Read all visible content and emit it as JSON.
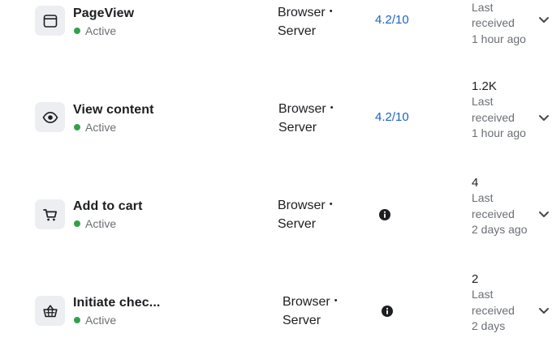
{
  "events": [
    {
      "icon": "browser-window-icon",
      "name": "PageView",
      "status": "Active",
      "integration_line1": "Browser",
      "integration_separator": "•",
      "integration_line2": "Server",
      "quality_score": "4.2/10",
      "count": "",
      "activity_label": "Last received",
      "activity_time": "1 hour ago"
    },
    {
      "icon": "eye-icon",
      "name": "View content",
      "status": "Active",
      "integration_line1": "Browser",
      "integration_separator": "•",
      "integration_line2": "Server",
      "quality_score": "4.2/10",
      "count": "1.2K",
      "activity_label": "Last received",
      "activity_time": "1 hour ago"
    },
    {
      "icon": "shopping-cart-icon",
      "name": "Add to cart",
      "status": "Active",
      "integration_line1": "Browser",
      "integration_separator": "•",
      "integration_line2": "Server",
      "quality_score_icon": "info-icon",
      "count": "4",
      "activity_label": "Last received",
      "activity_time": "2 days ago"
    },
    {
      "icon": "shopping-basket-icon",
      "name": "Initiate chec...",
      "status": "Active",
      "integration_line1": "Browser",
      "integration_separator": "•",
      "integration_line2": "Server",
      "quality_score_icon": "info-icon",
      "count": "2",
      "activity_label": "Last received",
      "activity_time": "2 days"
    }
  ],
  "colors": {
    "status_active": "#31a24c",
    "link_blue": "#1d63c6",
    "icon_box_bg": "#eceef1",
    "muted_text": "#6b6f74",
    "primary_text": "#1c1e21"
  }
}
